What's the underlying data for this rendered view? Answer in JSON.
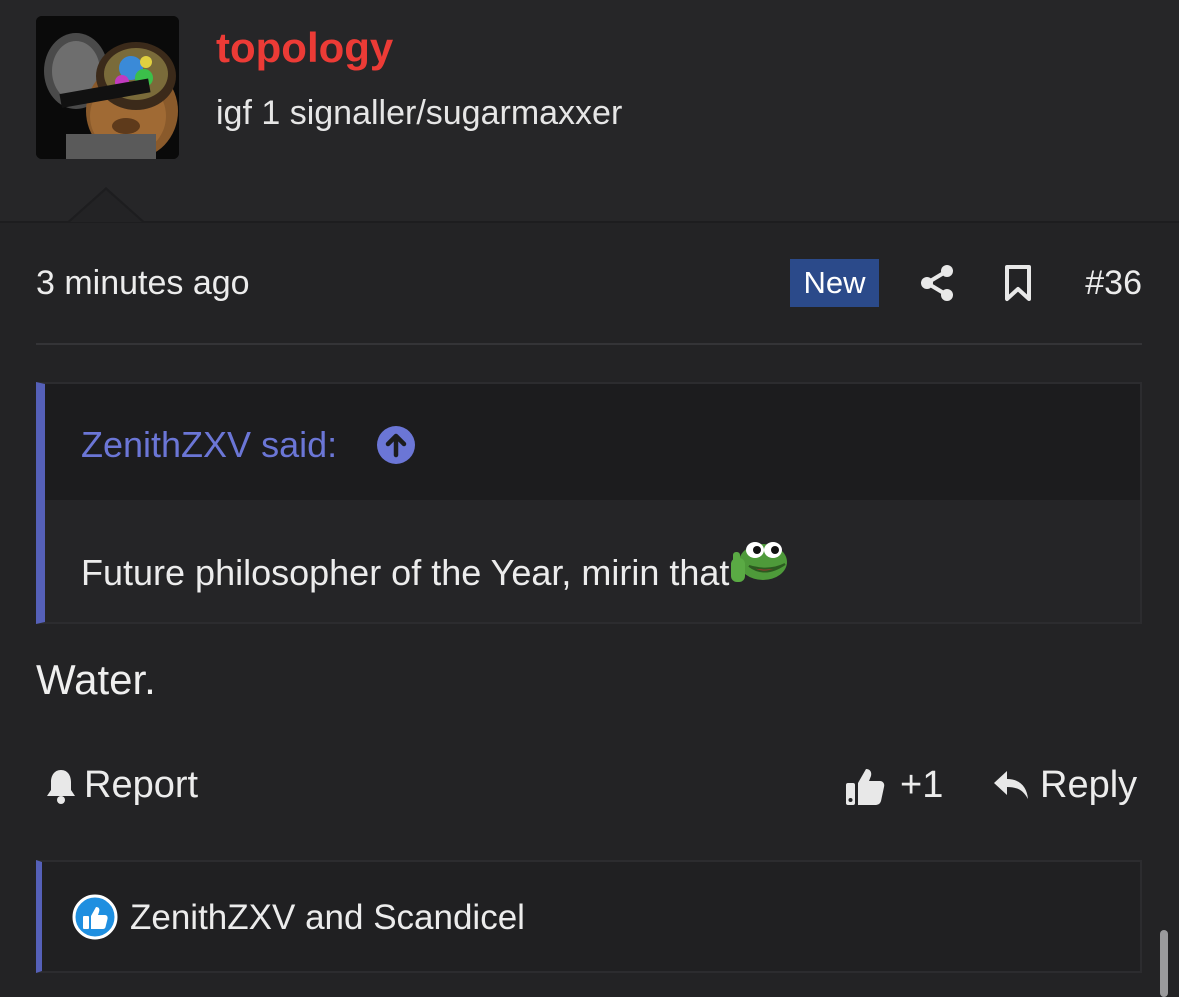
{
  "author": {
    "name": "topology",
    "title": "igf 1 signaller/sugarmaxxer",
    "avatar_icon": "avatar-image"
  },
  "post": {
    "time": "3 minutes ago",
    "badge": "New",
    "share_icon": "share-icon",
    "bookmark_icon": "bookmark-icon",
    "number": "#36"
  },
  "quote": {
    "author_text": "ZenithZXV said:",
    "arrow_icon": "arrow-up-circle-icon",
    "text": "Future philosopher of the Year, mirin that",
    "emoji": "pepe-thumbs-up-emoji"
  },
  "message": "Water.",
  "actions": {
    "report": "Report",
    "like": "+1",
    "reply": "Reply"
  },
  "reactions": {
    "text": "ZenithZXV and Scandicel",
    "icon": "like-reaction-icon"
  },
  "colors": {
    "background": "#232325",
    "username": "#ec3b36",
    "accent": "#5560b8",
    "link": "#6b76d6",
    "badge": "#2b4a8a"
  }
}
